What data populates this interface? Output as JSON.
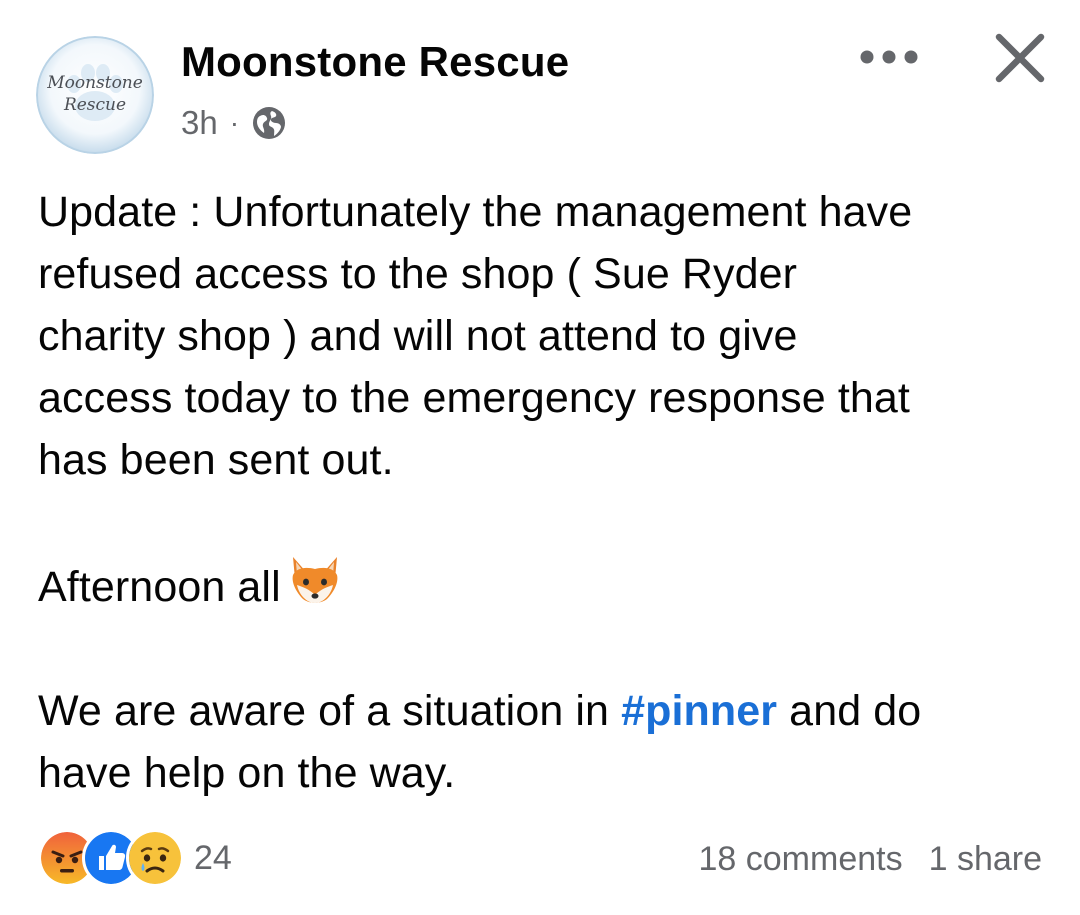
{
  "post": {
    "author": {
      "name": "Moonstone Rescue",
      "avatar_text_line1": "Moonstone",
      "avatar_text_line2": "Rescue"
    },
    "time": "3h",
    "separator": "·",
    "audience_icon": "globe-icon",
    "paragraphs": {
      "p1_lines": [
        "Update : Unfortunately the management have",
        "refused access to the shop ( Sue Ryder",
        "charity shop ) and will not attend to give",
        "access today to the emergency response that",
        "has been sent out."
      ],
      "p2_text": "Afternoon all",
      "p2_emoji": "fox-face-emoji",
      "p3_before": "We are aware of a situation in ",
      "p3_hashtag": "#pinner",
      "p3_after": " and do",
      "p3_line2": "have help on the way."
    },
    "reactions": {
      "icons": [
        "angry-reaction-icon",
        "like-reaction-icon",
        "sad-reaction-icon"
      ],
      "count": "24"
    },
    "comments": "18 comments",
    "shares": "1 share"
  },
  "colors": {
    "text": "#050505",
    "secondary": "#65676b",
    "link": "#1a6fd6",
    "like_blue": "#1877f2",
    "angry_red": "#e9513a",
    "emoji_yellow": "#f7b928"
  }
}
